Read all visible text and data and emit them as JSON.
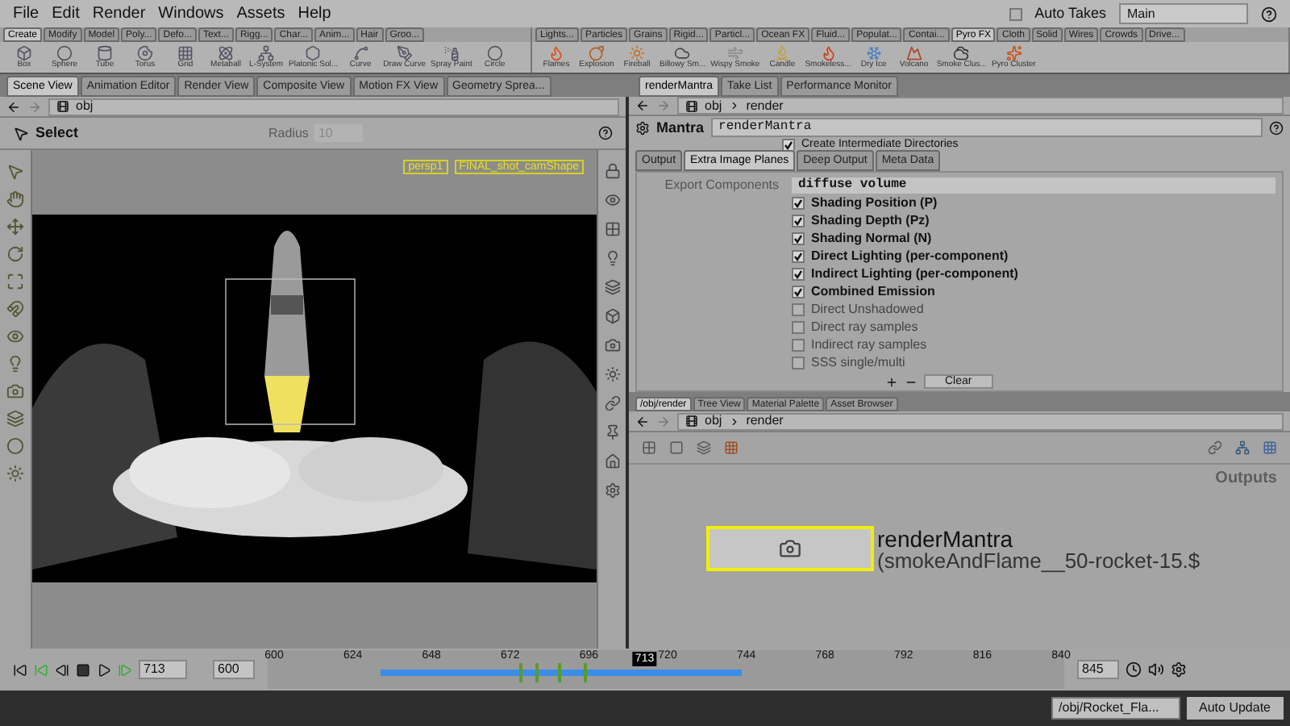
{
  "menu": [
    "File",
    "Edit",
    "Render",
    "Windows",
    "Assets",
    "Help"
  ],
  "auto_takes": {
    "label": "Auto Takes",
    "checked": false
  },
  "take": "Main",
  "shelf_left": {
    "tabs": [
      {
        "label": "Create",
        "selected": true
      },
      {
        "label": "Modify",
        "selected": false
      },
      {
        "label": "Model",
        "selected": false
      },
      {
        "label": "Poly...",
        "selected": false
      },
      {
        "label": "Defo...",
        "selected": false
      },
      {
        "label": "Text...",
        "selected": false
      },
      {
        "label": "Rigg...",
        "selected": false
      },
      {
        "label": "Char...",
        "selected": false
      },
      {
        "label": "Anim...",
        "selected": false
      },
      {
        "label": "Hair",
        "selected": false
      },
      {
        "label": "Groo...",
        "selected": false
      }
    ],
    "tools": [
      "Box",
      "Sphere",
      "Tube",
      "Torus",
      "Grid",
      "Metaball",
      "L-System",
      "Platonic Sol...",
      "Curve",
      "Draw Curve",
      "Spray Paint",
      "Circle"
    ]
  },
  "shelf_right": {
    "tabs": [
      {
        "label": "Lights...",
        "selected": false
      },
      {
        "label": "Particles",
        "selected": false
      },
      {
        "label": "Grains",
        "selected": false
      },
      {
        "label": "Rigid...",
        "selected": false
      },
      {
        "label": "Particl...",
        "selected": false
      },
      {
        "label": "Ocean FX",
        "selected": false
      },
      {
        "label": "Fluid...",
        "selected": false
      },
      {
        "label": "Populat...",
        "selected": false
      },
      {
        "label": "Contai...",
        "selected": false
      },
      {
        "label": "Pyro FX",
        "selected": true
      },
      {
        "label": "Cloth",
        "selected": false
      },
      {
        "label": "Solid",
        "selected": false
      },
      {
        "label": "Wires",
        "selected": false
      },
      {
        "label": "Crowds",
        "selected": false
      },
      {
        "label": "Drive...",
        "selected": false
      }
    ],
    "tools": [
      "Flames",
      "Explosion",
      "Fireball",
      "Billowy Sm...",
      "Wispy Smoke",
      "Candle",
      "Smokeless...",
      "Dry Ice",
      "Volcano",
      "Smoke Clus...",
      "Pyro Cluster"
    ]
  },
  "left_pane": {
    "tabs": [
      {
        "label": "Scene View",
        "selected": true
      },
      {
        "label": "Animation Editor",
        "selected": false
      },
      {
        "label": "Render View",
        "selected": false
      },
      {
        "label": "Composite View",
        "selected": false
      },
      {
        "label": "Motion FX View",
        "selected": false
      },
      {
        "label": "Geometry Sprea...",
        "selected": false
      }
    ],
    "path": "obj",
    "tool": "Select",
    "radius_label": "Radius",
    "radius_value": "10",
    "camera": "persp1",
    "camera_shape": "FINAL_shot_camShape"
  },
  "right_top": {
    "tabs": [
      {
        "label": "renderMantra",
        "selected": true
      },
      {
        "label": "Take List",
        "selected": false
      },
      {
        "label": "Performance Monitor",
        "selected": false
      }
    ],
    "path": [
      "obj",
      "render"
    ],
    "node_type": "Mantra",
    "node_name": "renderMantra",
    "hidden_row": {
      "label": "Create Intermediate Directories",
      "checked": true
    },
    "param_tabs": [
      {
        "label": "Output",
        "selected": false
      },
      {
        "label": "Extra Image Planes",
        "selected": true
      },
      {
        "label": "Deep Output",
        "selected": false
      },
      {
        "label": "Meta Data",
        "selected": false
      }
    ],
    "export_label": "Export Components",
    "export_value": "diffuse volume",
    "planes": [
      {
        "label": "Shading Position (P)",
        "checked": true
      },
      {
        "label": "Shading Depth (Pz)",
        "checked": true
      },
      {
        "label": "Shading Normal (N)",
        "checked": true
      },
      {
        "label": "Direct Lighting (per-component)",
        "checked": true
      },
      {
        "label": "Indirect Lighting (per-component)",
        "checked": true
      },
      {
        "label": "Combined Emission",
        "checked": true
      },
      {
        "label": "Direct Unshadowed",
        "checked": false
      },
      {
        "label": "Direct ray samples",
        "checked": false
      },
      {
        "label": "Indirect ray samples",
        "checked": false
      },
      {
        "label": "SSS single/multi",
        "checked": false
      }
    ],
    "clear_button": "Clear"
  },
  "right_bottom": {
    "tabs": [
      {
        "label": "/obj/render",
        "selected": true
      },
      {
        "label": "Tree View",
        "selected": false
      },
      {
        "label": "Material Palette",
        "selected": false
      },
      {
        "label": "Asset Browser",
        "selected": false
      }
    ],
    "path": [
      "obj",
      "render"
    ],
    "context": "Outputs",
    "node": {
      "name": "renderMantra",
      "detail": "(smokeAndFlame__50-rocket-15.$",
      "selected": true
    }
  },
  "timeline": {
    "frame": "713",
    "start": "600",
    "end": "845",
    "ticks": [
      "600",
      "624",
      "648",
      "672",
      "696",
      "720",
      "744",
      "768",
      "792",
      "816",
      "840"
    ],
    "current": "713"
  },
  "status": {
    "path": "/obj/Rocket_Fla...",
    "update": "Auto Update"
  }
}
